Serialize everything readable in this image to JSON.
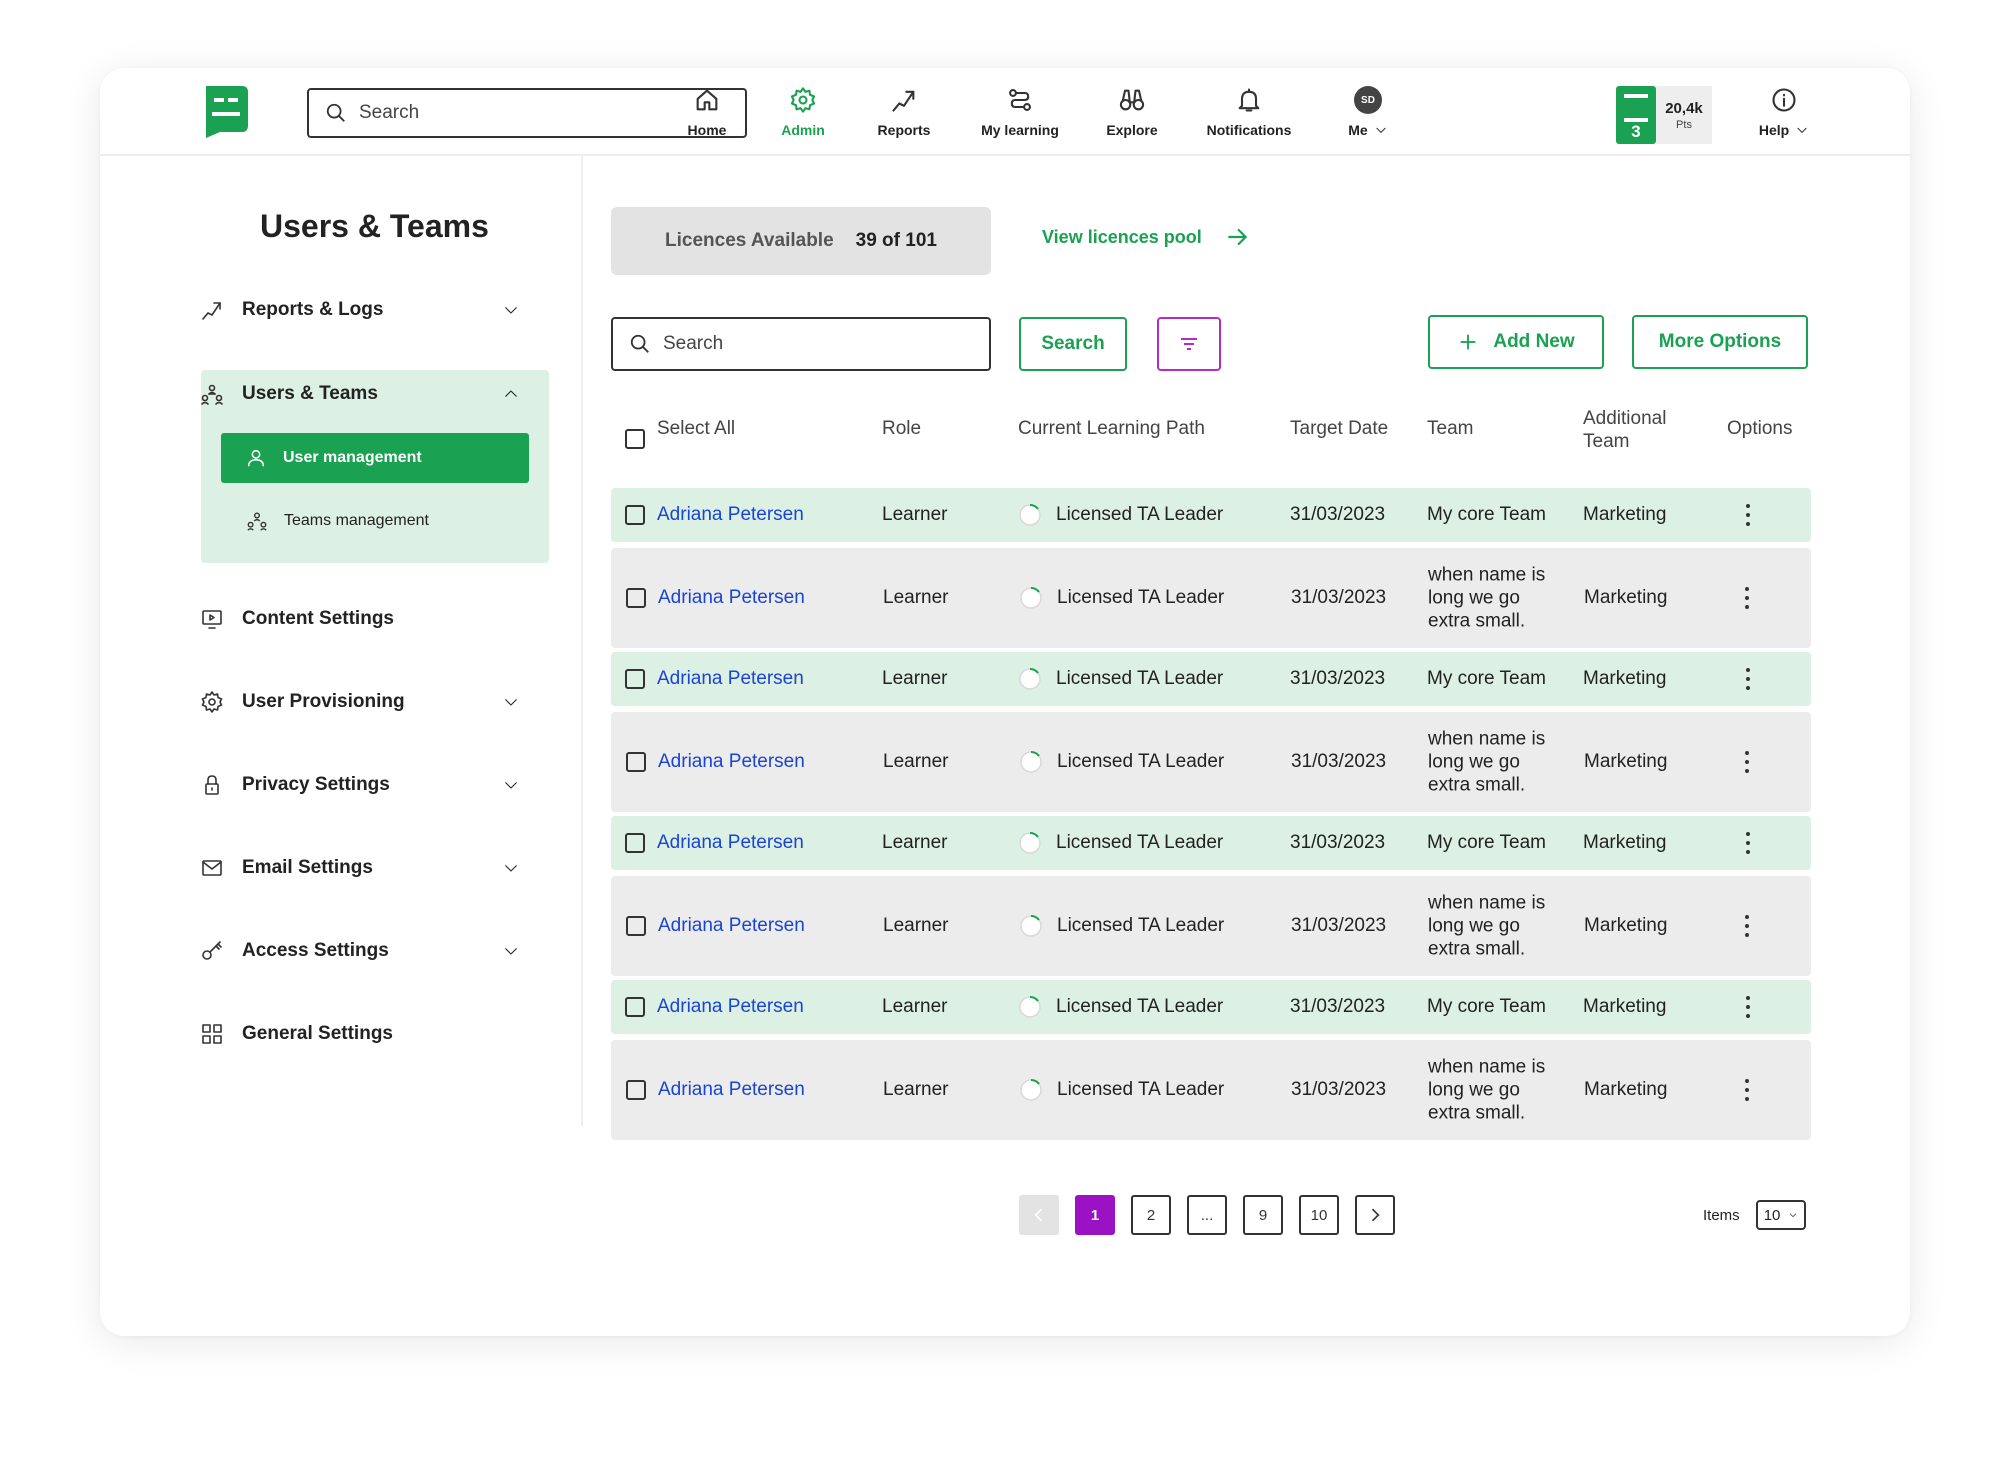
{
  "colors": {
    "brand_green": "#1aa152",
    "green_tint": "#dcf0e4",
    "grey_row": "#ececec",
    "link_blue": "#1a44d6",
    "accent_purple": "#9b12c4",
    "filter_purple": "#b32cc5"
  },
  "header": {
    "search_placeholder": "Search",
    "nav": [
      {
        "label": "Home",
        "icon": "home-icon"
      },
      {
        "label": "Admin",
        "icon": "gear-icon",
        "active": true
      },
      {
        "label": "Reports",
        "icon": "trend-icon"
      },
      {
        "label": "My learning",
        "icon": "path-icon"
      },
      {
        "label": "Explore",
        "icon": "binoculars-icon"
      },
      {
        "label": "Notifications",
        "icon": "bell-icon"
      },
      {
        "label": "Me",
        "icon": "avatar",
        "avatar_initials": "SD"
      },
      {
        "label": "Help",
        "icon": "info-icon"
      }
    ],
    "points": {
      "level": "3",
      "value": "20,4k",
      "unit": "Pts"
    }
  },
  "sidebar": {
    "title": "Users & Teams",
    "items": [
      {
        "label": "Reports & Logs",
        "icon": "trend-icon",
        "chevron": "down"
      },
      {
        "label": "Users & Teams",
        "icon": "team-icon",
        "chevron": "up"
      },
      {
        "label": "Content Settings",
        "icon": "monitor-icon"
      },
      {
        "label": "User Provisioning",
        "icon": "gear-icon",
        "chevron": "down"
      },
      {
        "label": "Privacy Settings",
        "icon": "lock-icon",
        "chevron": "down"
      },
      {
        "label": "Email Settings",
        "icon": "mail-icon",
        "chevron": "down"
      },
      {
        "label": "Access Settings",
        "icon": "key-icon",
        "chevron": "down"
      },
      {
        "label": "General Settings",
        "icon": "grid-icon"
      }
    ],
    "sub_items": [
      {
        "label": "User management",
        "icon": "user-icon",
        "selected": true
      },
      {
        "label": "Teams management",
        "icon": "team-icon"
      }
    ]
  },
  "licences": {
    "label": "Licences Available",
    "value": "39 of 101",
    "link": "View licences pool"
  },
  "toolbar": {
    "search_placeholder": "Search",
    "search_button": "Search",
    "add_new": "Add New",
    "more_options": "More Options"
  },
  "table": {
    "select_all": "Select All",
    "columns": [
      "Role",
      "Current Learning Path",
      "Target Date",
      "Team",
      "Additional Team",
      "Options"
    ],
    "rows": [
      {
        "name": "Adriana Petersen",
        "role": "Learner",
        "path": "Licensed TA Leader",
        "date": "31/03/2023",
        "team": "My core Team",
        "additional": "Marketing"
      },
      {
        "name": "Adriana Petersen",
        "role": "Learner",
        "path": "Licensed TA Leader",
        "date": "31/03/2023",
        "team": "when name is long we go extra small.",
        "additional": "Marketing"
      },
      {
        "name": "Adriana Petersen",
        "role": "Learner",
        "path": "Licensed TA Leader",
        "date": "31/03/2023",
        "team": "My core Team",
        "additional": "Marketing"
      },
      {
        "name": "Adriana Petersen",
        "role": "Learner",
        "path": "Licensed TA Leader",
        "date": "31/03/2023",
        "team": "when name is long we go extra small.",
        "additional": "Marketing"
      },
      {
        "name": "Adriana Petersen",
        "role": "Learner",
        "path": "Licensed TA Leader",
        "date": "31/03/2023",
        "team": "My core Team",
        "additional": "Marketing"
      },
      {
        "name": "Adriana Petersen",
        "role": "Learner",
        "path": "Licensed TA Leader",
        "date": "31/03/2023",
        "team": "when name is long we go extra small.",
        "additional": "Marketing"
      },
      {
        "name": "Adriana Petersen",
        "role": "Learner",
        "path": "Licensed TA Leader",
        "date": "31/03/2023",
        "team": "My core Team",
        "additional": "Marketing"
      },
      {
        "name": "Adriana Petersen",
        "role": "Learner",
        "path": "Licensed TA Leader",
        "date": "31/03/2023",
        "team": "when name is long we go extra small.",
        "additional": "Marketing"
      }
    ]
  },
  "pagination": {
    "pages": [
      "1",
      "2",
      "...",
      "9",
      "10"
    ],
    "current": "1",
    "items_label": "Items",
    "items_value": "10"
  }
}
